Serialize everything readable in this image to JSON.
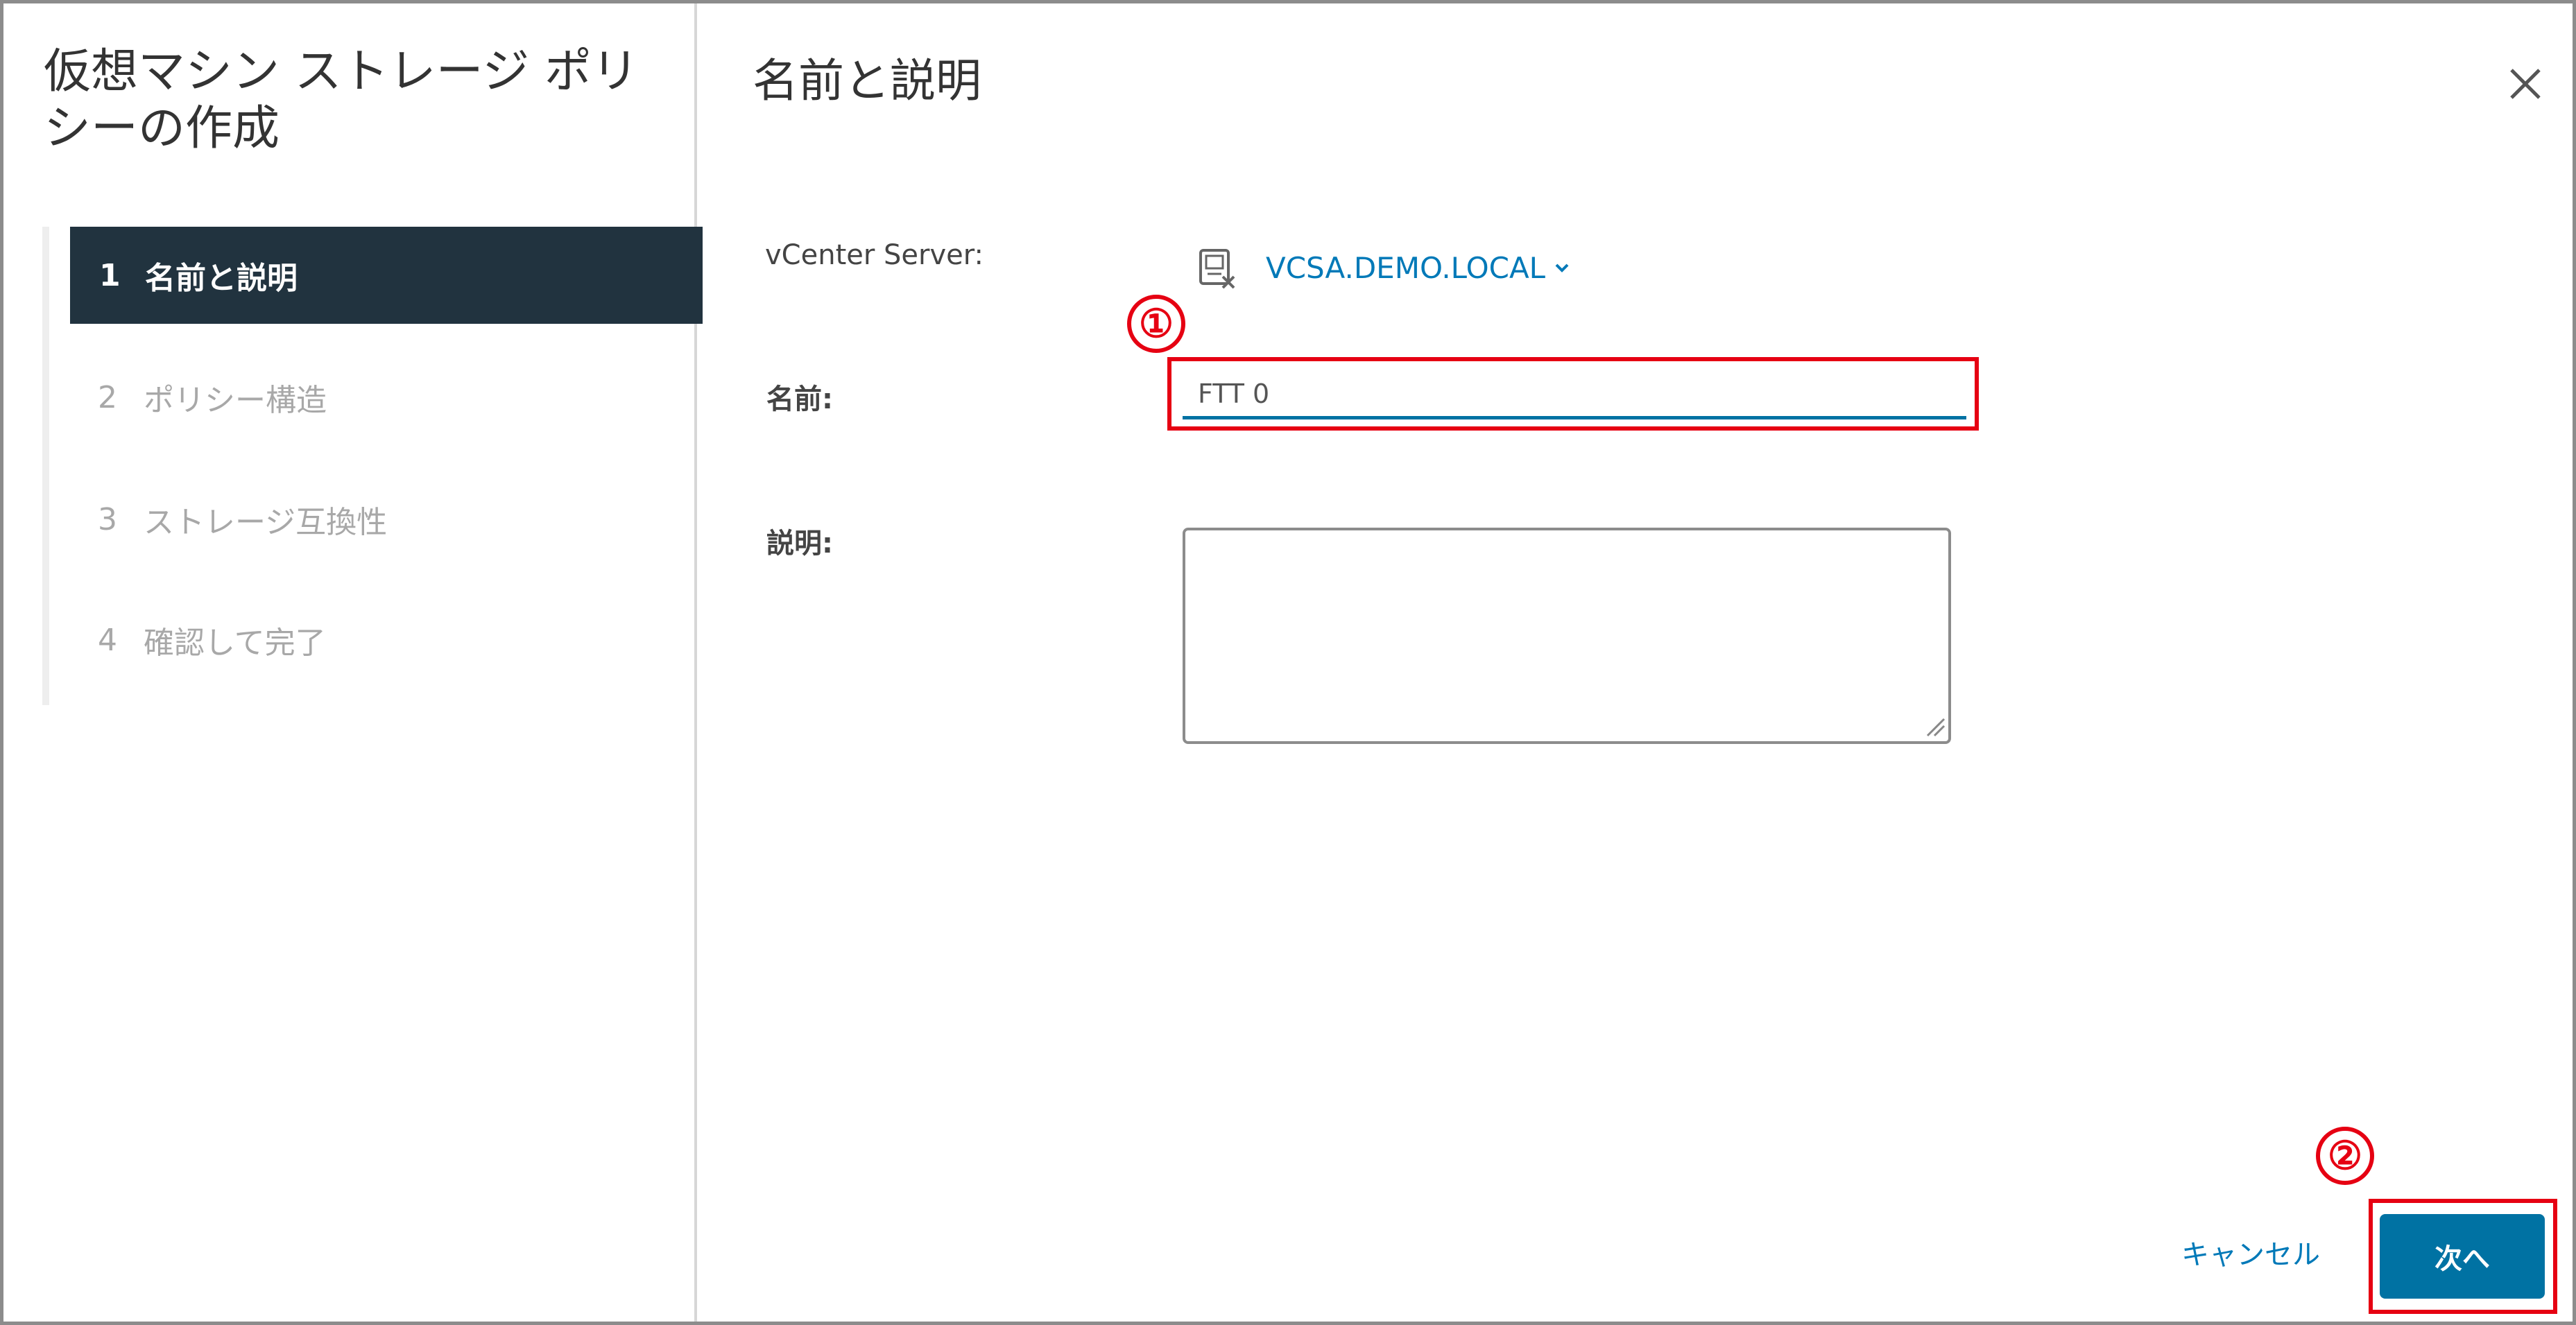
{
  "wizard": {
    "title": "仮想マシン ストレージ ポリシーの作成",
    "steps": [
      {
        "num": "1",
        "label": "名前と説明",
        "active": true
      },
      {
        "num": "2",
        "label": "ポリシー構造",
        "active": false
      },
      {
        "num": "3",
        "label": "ストレージ互換性",
        "active": false
      },
      {
        "num": "4",
        "label": "確認して完了",
        "active": false
      }
    ]
  },
  "content": {
    "title": "名前と説明",
    "vcenter_label": "vCenter Server:",
    "vcenter_value": "VCSA.DEMO.LOCAL",
    "name_label": "名前:",
    "name_value": "FTT 0",
    "description_label": "説明:",
    "description_value": ""
  },
  "annotations": {
    "marker_1": "①",
    "marker_2": "②",
    "color": "#e60012"
  },
  "footer": {
    "cancel_label": "キャンセル",
    "next_label": "次へ"
  },
  "colors": {
    "active_step_bg": "#21333f",
    "link": "#0079b8",
    "primary_button": "#0072a3"
  },
  "icons": {
    "close": "close-icon",
    "server": "vcenter-server-icon",
    "chevron": "chevron-down-icon",
    "resize": "resize-grip-icon"
  }
}
